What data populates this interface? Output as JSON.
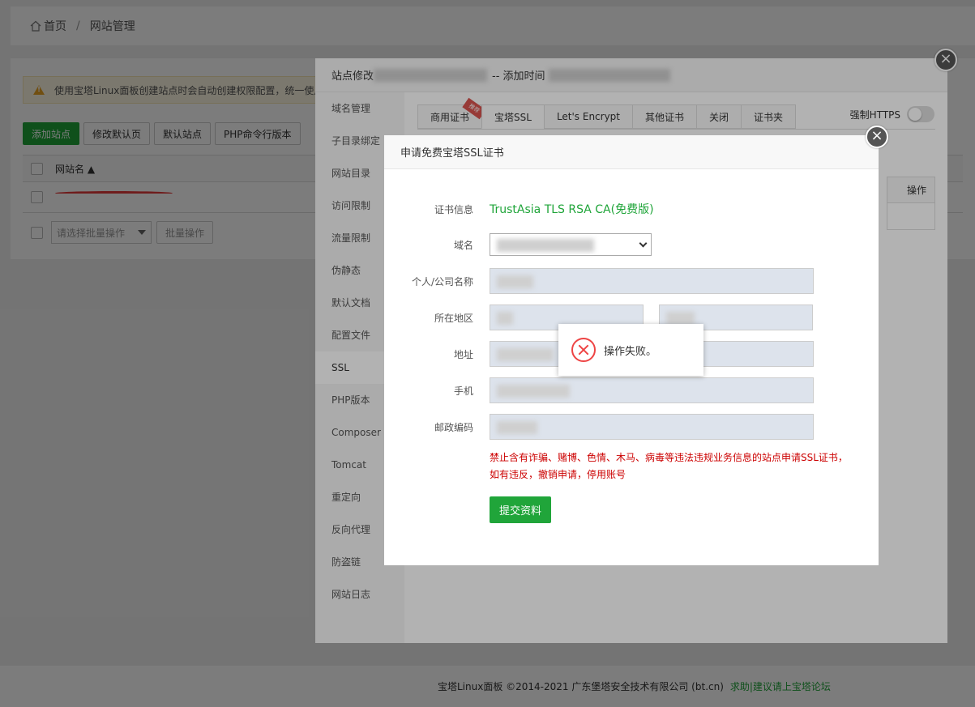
{
  "breadcrumb": {
    "home": "首页",
    "separator": "/",
    "current": "网站管理"
  },
  "page": {
    "warning": "使用宝塔Linux面板创建站点时会自动创建权限配置，统一使用",
    "buttons": {
      "add_site": "添加站点",
      "edit_default": "修改默认页",
      "default_site": "默认站点",
      "php_cli": "PHP命令行版本"
    },
    "table": {
      "col_site_name": "网站名 ▲"
    },
    "batch": {
      "placeholder": "请选择批量操作",
      "action": "批量操作"
    }
  },
  "site_dialog": {
    "title_prefix": "站点修改",
    "title_mid": "-- 添加时间",
    "sidebar": [
      "域名管理",
      "子目录绑定",
      "网站目录",
      "访问限制",
      "流量限制",
      "伪静态",
      "默认文档",
      "配置文件",
      "SSL",
      "PHP版本",
      "Composer",
      "Tomcat",
      "重定向",
      "反向代理",
      "防盗链",
      "网站日志"
    ],
    "active_item": "SSL",
    "tabs": [
      {
        "label": "商用证书",
        "badge": "推荐"
      },
      {
        "label": "宝塔SSL"
      },
      {
        "label": "Let's Encrypt"
      },
      {
        "label": "其他证书"
      },
      {
        "label": "关闭"
      },
      {
        "label": "证书夹"
      }
    ],
    "https_label": "强制HTTPS",
    "op_header": "操作"
  },
  "ssl_dialog": {
    "title": "申请免费宝塔SSL证书",
    "cert_label": "证书信息",
    "cert_value": "TrustAsia TLS RSA CA(免费版)",
    "domain_label": "域名",
    "company_label": "个人/公司名称",
    "region_label": "所在地区",
    "address_label": "地址",
    "phone_label": "手机",
    "zip_label": "邮政编码",
    "notice_line1": "禁止含有诈骗、赌博、色情、木马、病毒等违法违规业务信息的站点申请SSL证书，",
    "notice_line2": "如有违反，撤销申请，停用账号",
    "submit": "提交资料"
  },
  "toast": {
    "message": "操作失败。"
  },
  "footer": {
    "copyright": "宝塔Linux面板 ©2014-2021 广东堡塔安全技术有限公司 (bt.cn)",
    "link": "求助|建议请上宝塔论坛"
  },
  "colors": {
    "accent": "#20a53a",
    "error": "#e44444",
    "notice": "#cc0000"
  }
}
